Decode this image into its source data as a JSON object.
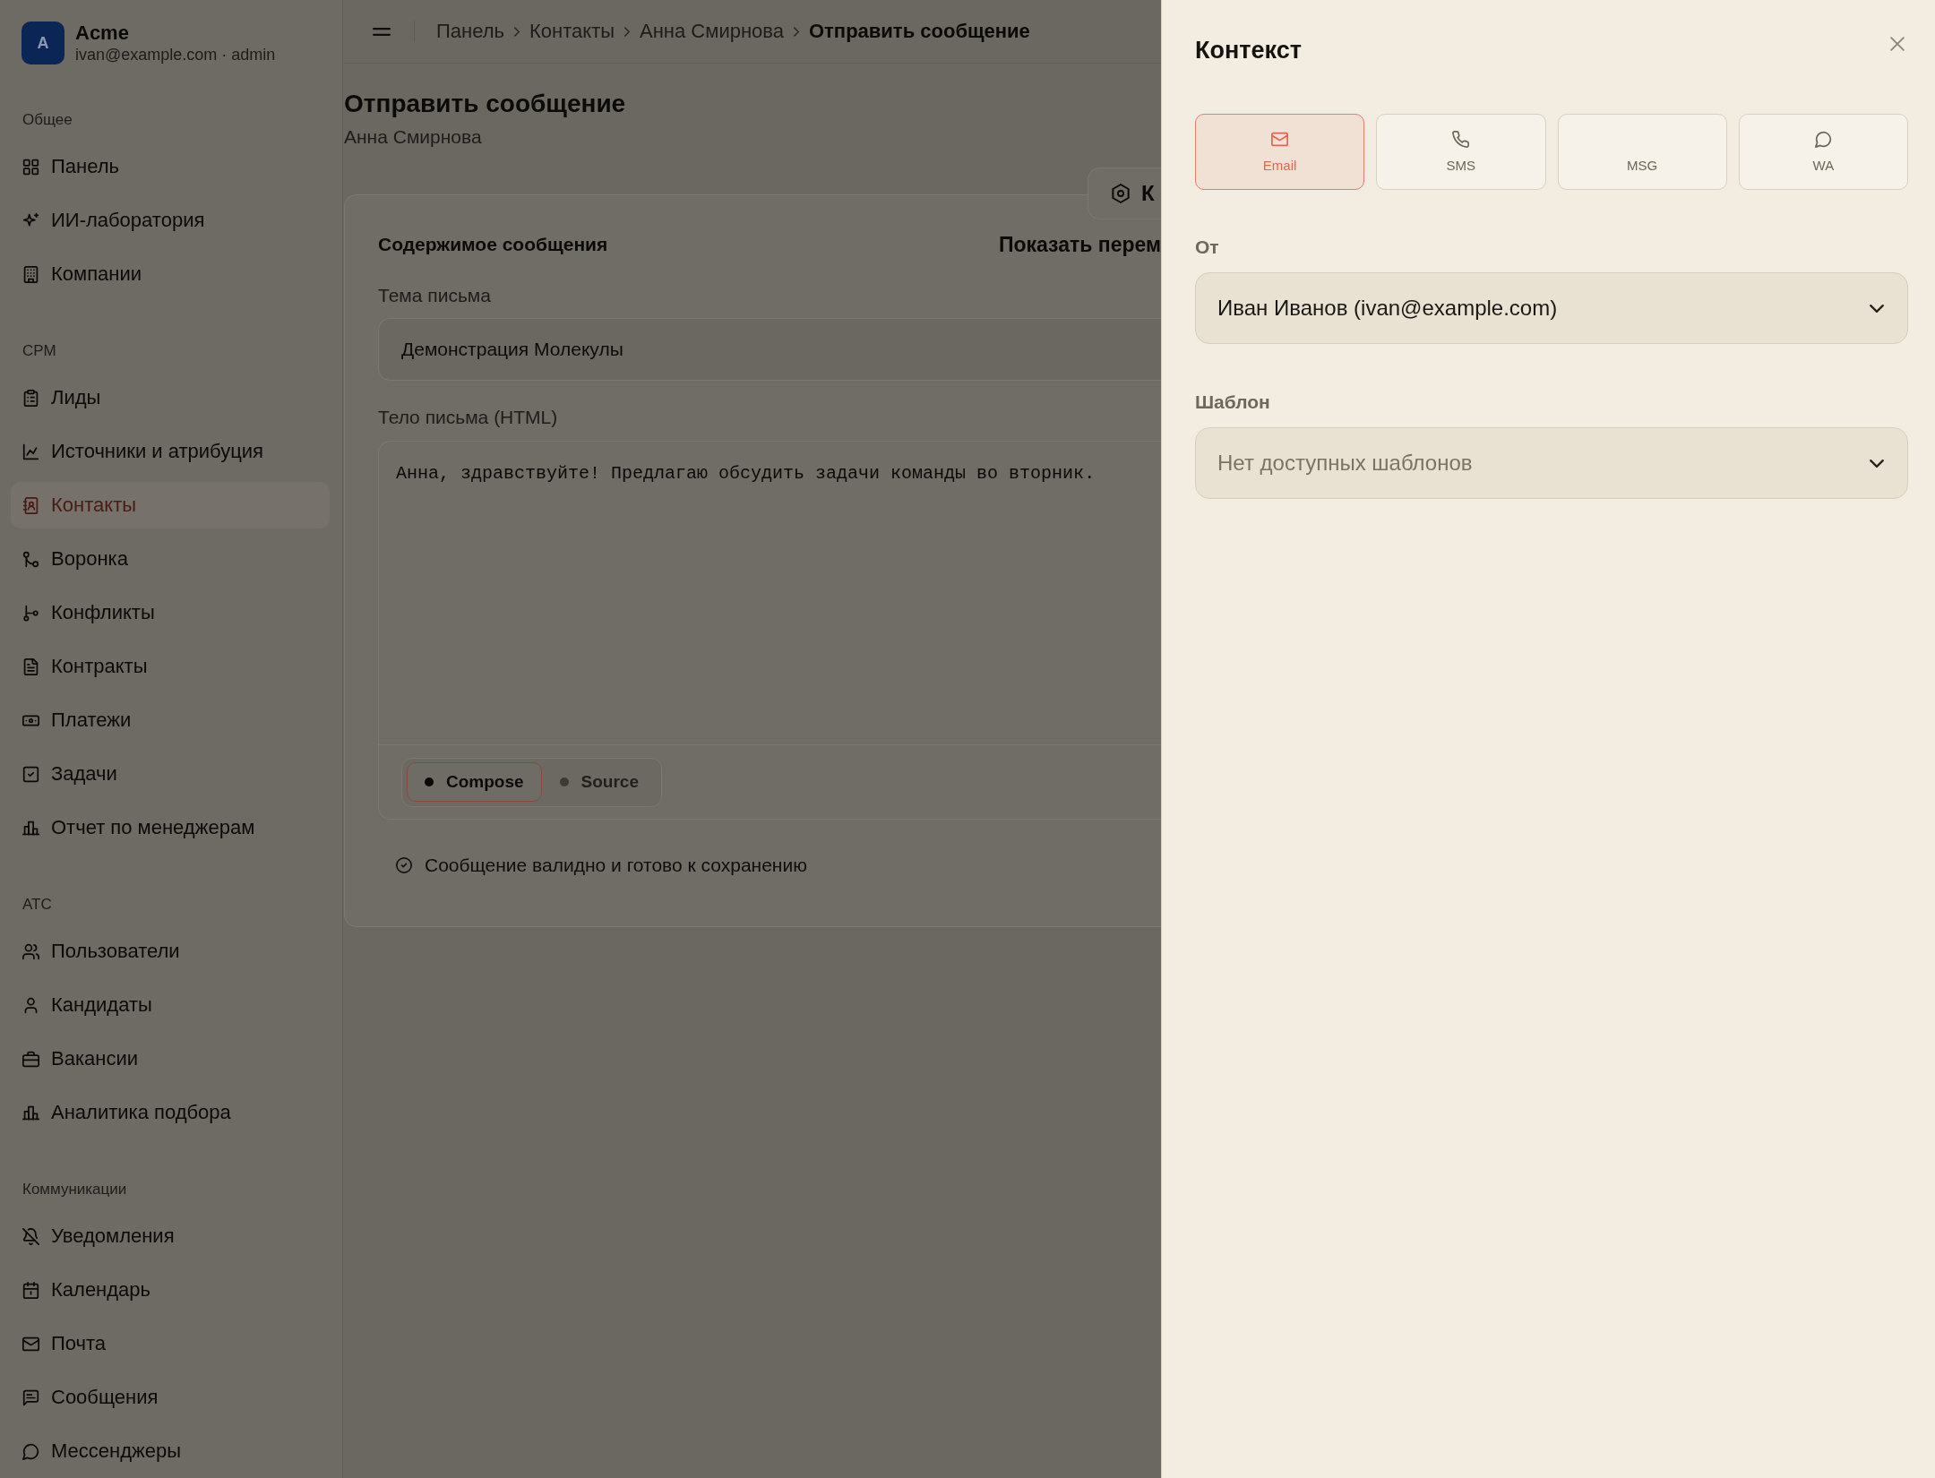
{
  "sidebar": {
    "workspace": {
      "initial": "A",
      "name": "Acme",
      "account": "ivan@example.com · admin"
    },
    "sections": [
      {
        "title": "Общее",
        "items": [
          {
            "label": "Панель",
            "selected": false
          },
          {
            "label": "ИИ-лаборатория",
            "selected": false
          },
          {
            "label": "Компании",
            "selected": false
          }
        ]
      },
      {
        "title": "СРМ",
        "items": [
          {
            "label": "Лиды",
            "selected": false
          },
          {
            "label": "Источники и атрибуция",
            "selected": false
          },
          {
            "label": "Контакты",
            "selected": true
          },
          {
            "label": "Воронка",
            "selected": false
          },
          {
            "label": "Конфликты",
            "selected": false
          },
          {
            "label": "Контракты",
            "selected": false
          },
          {
            "label": "Платежи",
            "selected": false
          },
          {
            "label": "Задачи",
            "selected": false
          },
          {
            "label": "Отчет по менеджерам",
            "selected": false
          }
        ]
      },
      {
        "title": "АТС",
        "items": [
          {
            "label": "Пользователи",
            "selected": false
          },
          {
            "label": "Кандидаты",
            "selected": false
          },
          {
            "label": "Вакансии",
            "selected": false
          },
          {
            "label": "Аналитика подбора",
            "selected": false
          }
        ]
      },
      {
        "title": "Коммуникации",
        "items": [
          {
            "label": "Уведомления",
            "selected": false
          },
          {
            "label": "Календарь",
            "selected": false
          },
          {
            "label": "Почта",
            "selected": false
          },
          {
            "label": "Сообщения",
            "selected": false
          },
          {
            "label": "Мессенджеры",
            "selected": false
          }
        ]
      }
    ]
  },
  "topbar": {
    "breadcrumbs": [
      {
        "label": "Панель",
        "current": false
      },
      {
        "label": "Контакты",
        "current": false
      },
      {
        "label": "Анна Смирнова",
        "current": false
      },
      {
        "label": "Отправить сообщение",
        "current": true
      }
    ]
  },
  "page": {
    "title": "Отправить сообщение",
    "subtitle": "Анна Смирнова",
    "panel_button": "К"
  },
  "card": {
    "title": "Содержимое сообщения",
    "toggle_link": "Показать перем",
    "subject": {
      "label": "Тема письма",
      "value": "Демонстрация Молекулы"
    },
    "body": {
      "label": "Тело письма (HTML)",
      "value": "Анна, здравствуйте! Предлагаю обсудить задачи команды во вторник.",
      "modes": [
        {
          "label": "Compose",
          "selected": true
        },
        {
          "label": "Source",
          "selected": false
        }
      ]
    },
    "status": "Сообщение валидно и готово к сохранению"
  },
  "drawer": {
    "title": "Контекст",
    "channels": [
      {
        "kind": "mail",
        "label": "Email",
        "selected": true
      },
      {
        "kind": "phone",
        "label": "SMS",
        "selected": false
      },
      {
        "kind": "plain",
        "label": "MSG",
        "selected": false
      },
      {
        "kind": "chat",
        "label": "WA",
        "selected": false
      }
    ],
    "from": {
      "label": "От",
      "value": "Иван Иванов (ivan@example.com)"
    },
    "template": {
      "label": "Шаблон",
      "placeholder": "Нет доступных шаблонов"
    }
  }
}
